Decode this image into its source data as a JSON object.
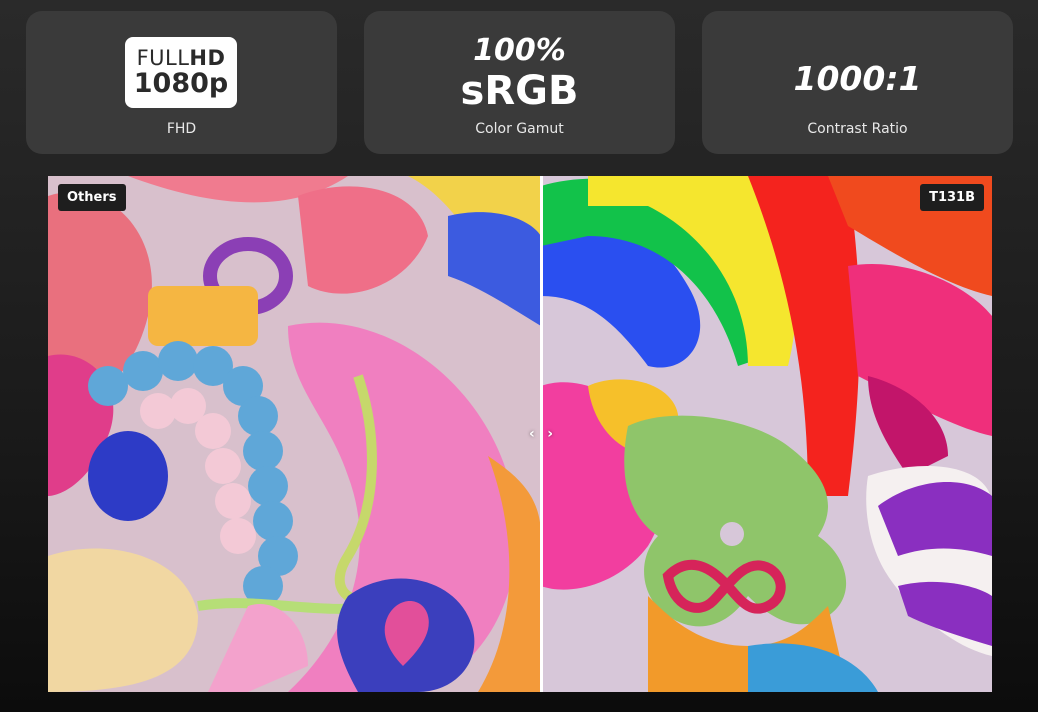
{
  "features": [
    {
      "badge_line1_light": "FULL",
      "badge_line1_bold": "HD",
      "badge_line2": "1080p",
      "label": "FHD"
    },
    {
      "value_top": "100%",
      "value_bottom": "sRGB",
      "label": "Color Gamut"
    },
    {
      "value": "1000:1",
      "label": "Contrast Ratio"
    }
  ],
  "comparison": {
    "left_tag": "Others",
    "right_tag": "T131B",
    "handle_left_icon": "chevron-left-icon",
    "handle_right_icon": "chevron-right-icon",
    "handle_left_glyph": "‹",
    "handle_right_glyph": "›"
  },
  "colors": {
    "card_bg": "#3a3a3a",
    "tag_bg": "#1e1e1e",
    "divider": "#ffffff"
  }
}
